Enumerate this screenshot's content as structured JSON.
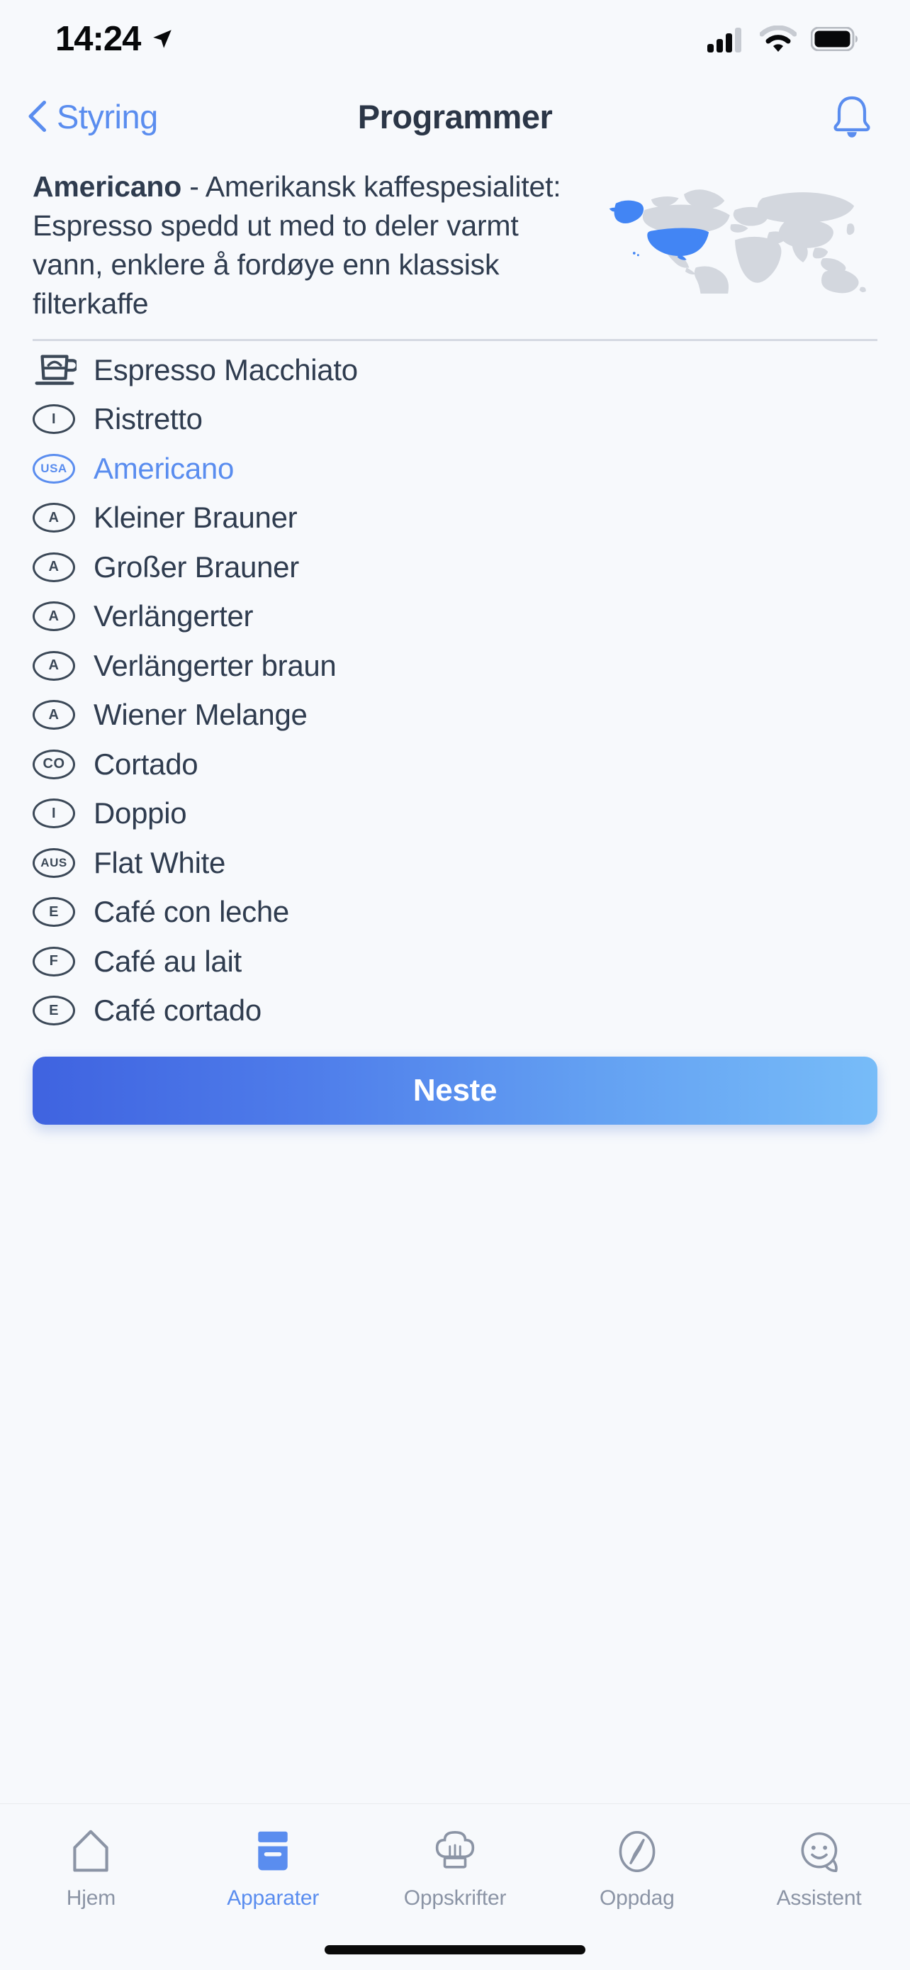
{
  "status_bar": {
    "time": "14:24",
    "location_icon": "location-arrow-icon",
    "cellular_icon": "cellular-signal-icon",
    "wifi_icon": "wifi-icon",
    "battery_icon": "battery-icon"
  },
  "nav": {
    "back_label": "Styring",
    "back_icon": "chevron-left-icon",
    "title": "Programmer",
    "bell_icon": "bell-icon"
  },
  "description": {
    "name": "Americano",
    "separator": " - ",
    "text": "Amerikansk kaffespesialitet: Espresso spedd ut med to deler varmt vann, enklere å fordøye enn klassisk filterkaffe",
    "map_icon": "world-map-usa-highlighted",
    "map_highlight_color": "#4285F4",
    "map_base_color": "#D3D7DE"
  },
  "list": {
    "items": [
      {
        "icon": "coffee-cup-icon",
        "badge": "",
        "label": "Espresso Macchiato",
        "selected": false
      },
      {
        "icon": "country-badge-icon",
        "badge": "I",
        "label": "Ristretto",
        "selected": false
      },
      {
        "icon": "country-badge-icon",
        "badge": "USA",
        "label": "Americano",
        "selected": true
      },
      {
        "icon": "country-badge-icon",
        "badge": "A",
        "label": "Kleiner Brauner",
        "selected": false
      },
      {
        "icon": "country-badge-icon",
        "badge": "A",
        "label": "Großer Brauner",
        "selected": false
      },
      {
        "icon": "country-badge-icon",
        "badge": "A",
        "label": "Verlängerter",
        "selected": false
      },
      {
        "icon": "country-badge-icon",
        "badge": "A",
        "label": "Verlängerter braun",
        "selected": false
      },
      {
        "icon": "country-badge-icon",
        "badge": "A",
        "label": "Wiener Melange",
        "selected": false
      },
      {
        "icon": "country-badge-icon",
        "badge": "CO",
        "label": "Cortado",
        "selected": false
      },
      {
        "icon": "country-badge-icon",
        "badge": "I",
        "label": "Doppio",
        "selected": false
      },
      {
        "icon": "country-badge-icon",
        "badge": "AUS",
        "label": "Flat White",
        "selected": false
      },
      {
        "icon": "country-badge-icon",
        "badge": "E",
        "label": "Café con leche",
        "selected": false
      },
      {
        "icon": "country-badge-icon",
        "badge": "F",
        "label": "Café au lait",
        "selected": false
      },
      {
        "icon": "country-badge-icon",
        "badge": "E",
        "label": "Café cortado",
        "selected": false
      }
    ]
  },
  "cta": {
    "label": "Neste",
    "gradient_from": "#3F63E0",
    "gradient_to": "#77BCF8"
  },
  "tabbar": {
    "active_color": "#5A8DEF",
    "inactive_color": "#8B94A5",
    "tabs": [
      {
        "label": "Hjem",
        "icon": "home-icon",
        "active": false
      },
      {
        "label": "Apparater",
        "icon": "appliance-icon",
        "active": true
      },
      {
        "label": "Oppskrifter",
        "icon": "chef-hat-icon",
        "active": false
      },
      {
        "label": "Oppdag",
        "icon": "compass-icon",
        "active": false
      },
      {
        "label": "Assistent",
        "icon": "smiley-chat-icon",
        "active": false
      }
    ]
  }
}
